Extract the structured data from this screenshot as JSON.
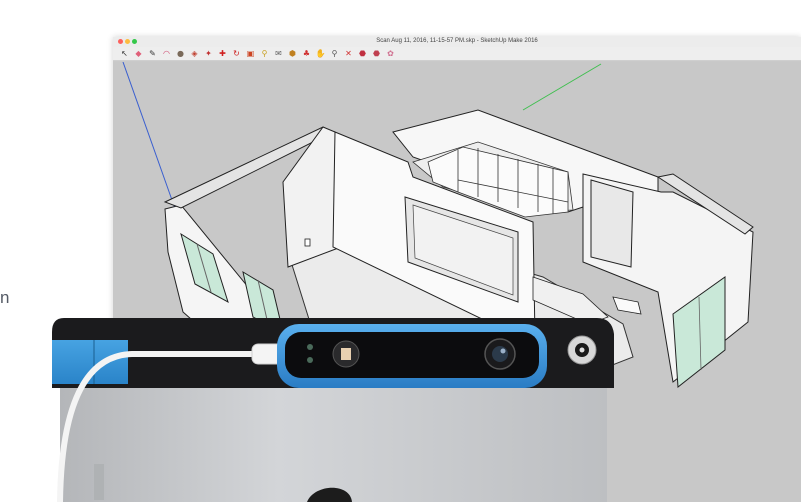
{
  "page": {
    "side_text": "n"
  },
  "window": {
    "title": "Scan Aug 11, 2016, 11-15-57 PM.skp - SketchUp Make 2016",
    "traffic_lights": [
      "close",
      "minimize",
      "zoom"
    ],
    "toolbar_tools": [
      {
        "name": "select-tool-icon",
        "glyph": "↖",
        "color": "#333333"
      },
      {
        "name": "eraser-tool-icon",
        "glyph": "◆",
        "color": "#e0607a"
      },
      {
        "name": "pencil-tool-icon",
        "glyph": "✎",
        "color": "#333333"
      },
      {
        "name": "arc-tool-icon",
        "glyph": "◠",
        "color": "#d04a70"
      },
      {
        "name": "shape-tool-icon",
        "glyph": "●",
        "color": "#7a6a5a"
      },
      {
        "name": "push-pull-tool-icon",
        "glyph": "◈",
        "color": "#c04030"
      },
      {
        "name": "offset-tool-icon",
        "glyph": "✦",
        "color": "#c03030"
      },
      {
        "name": "move-tool-icon",
        "glyph": "✚",
        "color": "#d02020"
      },
      {
        "name": "rotate-tool-icon",
        "glyph": "↻",
        "color": "#cc2020"
      },
      {
        "name": "scale-tool-icon",
        "glyph": "▣",
        "color": "#cc4422"
      },
      {
        "name": "tape-measure-icon",
        "glyph": "⚲",
        "color": "#c8a020"
      },
      {
        "name": "text-tool-icon",
        "glyph": "✉",
        "color": "#666666"
      },
      {
        "name": "paint-bucket-icon",
        "glyph": "⬢",
        "color": "#c08020"
      },
      {
        "name": "orbit-tool-icon",
        "glyph": "♣",
        "color": "#d03030"
      },
      {
        "name": "pan-tool-icon",
        "glyph": "✋",
        "color": "#d0a040"
      },
      {
        "name": "zoom-tool-icon",
        "glyph": "⚲",
        "color": "#555555"
      },
      {
        "name": "zoom-extents-icon",
        "glyph": "✕",
        "color": "#d03030"
      },
      {
        "name": "warehouse-icon",
        "glyph": "⬣",
        "color": "#c03040"
      },
      {
        "name": "extension-icon",
        "glyph": "⬣",
        "color": "#c04050"
      },
      {
        "name": "layout-icon",
        "glyph": "✿",
        "color": "#d07090"
      }
    ]
  },
  "colors": {
    "sensor_blue": "#3a8fd6",
    "bracket_blue": "#2a8fd0",
    "viewport_bg": "#c8c8c8",
    "wall_face": "#f7f7f7",
    "window_glass": "#c9e8d8",
    "ipad_silver": "#c7c9cc",
    "case_black": "#1b1b1d"
  }
}
